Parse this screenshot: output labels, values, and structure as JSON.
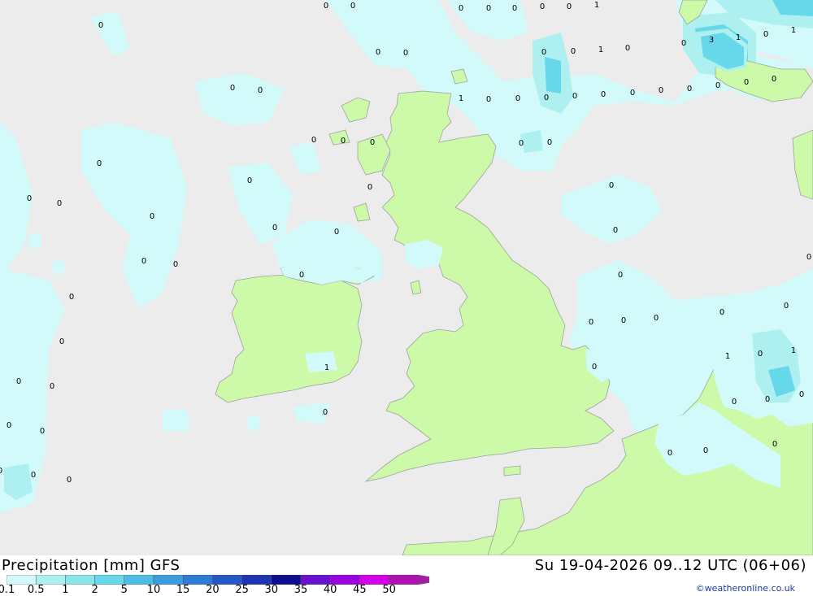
{
  "header": {
    "title": "Precipitation [mm] GFS",
    "datetime": "Su 19-04-2026 09..12 UTC (06+06)"
  },
  "legend": {
    "ticks": [
      "0.1",
      "0.5",
      "1",
      "2",
      "5",
      "10",
      "15",
      "20",
      "25",
      "30",
      "35",
      "40",
      "45",
      "50"
    ],
    "colors": [
      "#d3fafa",
      "#aef0f0",
      "#8ae6e6",
      "#66d8ea",
      "#4cbde6",
      "#3c9ce0",
      "#2f7bd8",
      "#2458c8",
      "#1d35b0",
      "#0c0e90",
      "#6a10d0",
      "#9a00e0",
      "#d400e8",
      "#b010b0",
      "#a020a0"
    ]
  },
  "map": {
    "colors": {
      "sea": "#ececec",
      "land": "#ccfaa8",
      "rain_light": "#d3fafa",
      "rain_mid": "#aef0f0",
      "rain_heavy": "#66d8ea",
      "coast": "#a0a0a0"
    },
    "labels": [
      "0",
      "0",
      "0",
      "0",
      "0",
      "0",
      "0",
      "1",
      "0",
      "0",
      "0",
      "0",
      "0",
      "1",
      "0",
      "0",
      "3",
      "1",
      "0",
      "1",
      "0",
      "0",
      "0",
      "0",
      "0",
      "1",
      "0",
      "0",
      "0",
      "0",
      "0",
      "0",
      "0",
      "0",
      "0",
      "0",
      "0",
      "0",
      "0",
      "0",
      "0",
      "0",
      "0",
      "0",
      "0",
      "0",
      "0",
      "0",
      "0",
      "0",
      "0",
      "0",
      "0",
      "0",
      "0",
      "0",
      "0",
      "0",
      "0",
      "0",
      "0",
      "1",
      "0",
      "1",
      "1",
      "0",
      "0",
      "0",
      "0",
      "0",
      "0",
      "0",
      "0"
    ]
  },
  "credit": "©weatheronline.co.uk"
}
